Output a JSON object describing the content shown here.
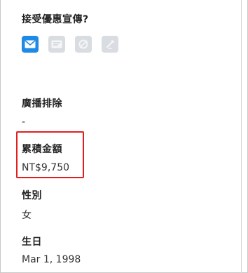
{
  "marketing": {
    "label": "接受優惠宣傳?",
    "channels": [
      {
        "icon": "email-icon",
        "enabled": true
      },
      {
        "icon": "sms-icon",
        "enabled": false
      },
      {
        "icon": "phone-icon",
        "enabled": false
      },
      {
        "icon": "app-push-icon",
        "enabled": false
      }
    ]
  },
  "broadcast_exclusion": {
    "label": "廣播排除",
    "value": "-"
  },
  "cumulative_amount": {
    "label": "累積金額",
    "value": "NT$9,750"
  },
  "gender": {
    "label": "性別",
    "value": "女"
  },
  "birthday": {
    "label": "生日",
    "value": "Mar 1, 1998"
  },
  "colors": {
    "accent": "#1f8ae6",
    "disabled": "#d9dde1",
    "highlight": "#e02020"
  }
}
